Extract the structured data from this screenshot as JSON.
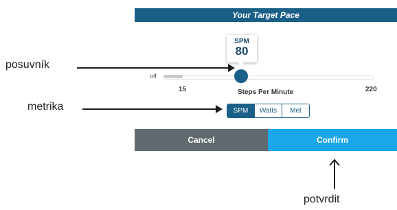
{
  "dialog": {
    "title": "Your Target Pace",
    "slider": {
      "value_caption": "SPM",
      "value": "80",
      "off_label": "off",
      "min_label": "15",
      "max_label": "220",
      "axis_label": "Steps Per Minute",
      "min": 15,
      "max": 220,
      "current": 80
    },
    "metric_tabs": [
      "SPM",
      "Watts",
      "Met"
    ],
    "selected_metric": "SPM",
    "cancel_label": "Cancel",
    "confirm_label": "Confirm"
  },
  "annotations": {
    "slider": "posuvník",
    "metric": "metrika",
    "confirm": "potvrdit"
  },
  "colors": {
    "primary": "#1a5f87",
    "confirm": "#1aa6e8",
    "cancel": "#616a6f"
  }
}
